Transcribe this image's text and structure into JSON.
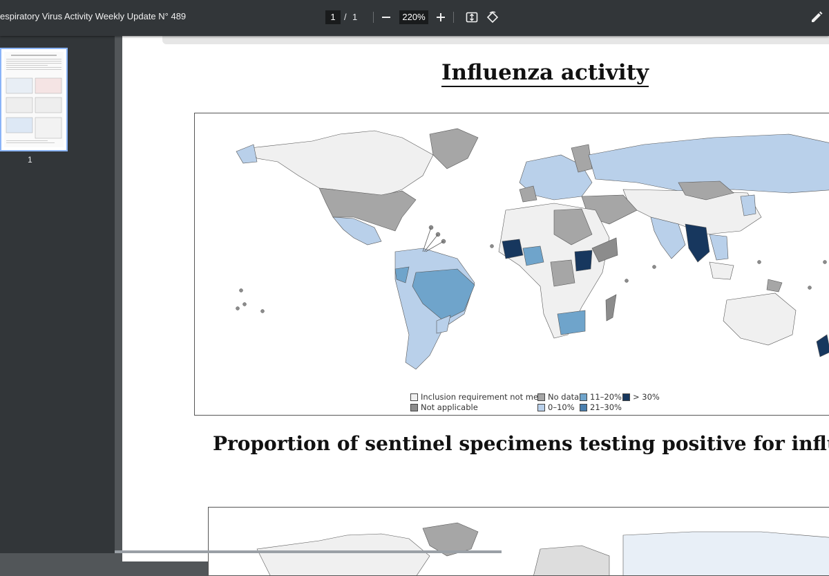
{
  "toolbar": {
    "doc_title": "espiratory Virus Activity Weekly Update N° 489",
    "current_page": "1",
    "page_separator": "/",
    "total_pages": "1",
    "zoom": "220%",
    "icons": [
      "minus-icon",
      "plus-icon",
      "fit-page-icon",
      "rotate-icon",
      "edit-icon"
    ]
  },
  "sidebar": {
    "thumbnail_label": "1"
  },
  "page": {
    "heading_1": "Influenza activity",
    "heading_2": "Proportion of sentinel specimens testing positive for influen",
    "legend": [
      {
        "label": "Inclusion requirement not met",
        "color": "#f0f0f0"
      },
      {
        "label": "Not applicable",
        "color": "#8c8c8c"
      },
      {
        "label": "No data",
        "color": "#a6a6a6"
      },
      {
        "label": "0–10%",
        "color": "#b9d0ea"
      },
      {
        "label": "11–20%",
        "color": "#6fa4cb"
      },
      {
        "label": "21–30%",
        "color": "#4a7fae"
      },
      {
        "label": "> 30%",
        "color": "#17375e"
      }
    ]
  }
}
